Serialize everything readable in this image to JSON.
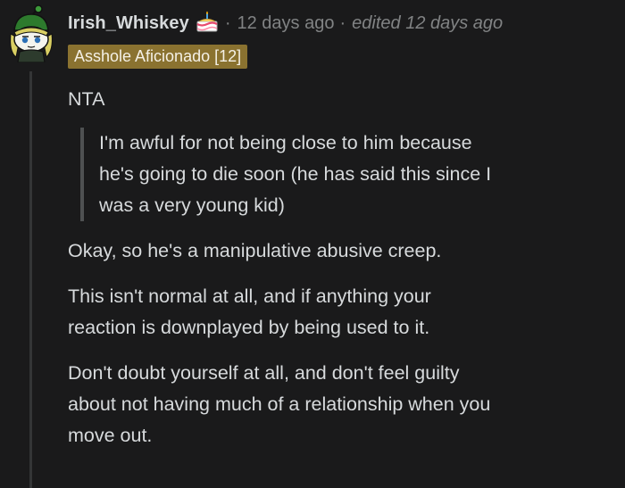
{
  "comment": {
    "author": "Irish_Whiskey",
    "separator_1": "·",
    "timestamp": "12 days ago",
    "separator_2": "·",
    "edited": "edited 12 days ago",
    "flair": "Asshole Aficionado [12]",
    "avatar_icon": "snoo-avatar-icon",
    "author_badge_icon": "cake-icon",
    "colors": {
      "background": "#1a1a1b",
      "text": "#d7dadc",
      "meta": "#818384",
      "flair_bg": "#8a7230",
      "thread_line": "#343536"
    },
    "body": {
      "verdict": "NTA",
      "quote_lines": [
        "I'm awful for not being close to him because",
        "he's going to die soon (he has said this since I",
        "was a very young kid)"
      ],
      "paragraph_1": "Okay, so he's a manipulative abusive creep.",
      "paragraph_2_lines": [
        "This isn't normal at all, and if anything your",
        "reaction is downplayed by being used to it."
      ],
      "paragraph_3_lines": [
        "Don't doubt yourself at all, and don't feel guilty",
        "about not having much of a relationship when you",
        "move out."
      ]
    }
  }
}
